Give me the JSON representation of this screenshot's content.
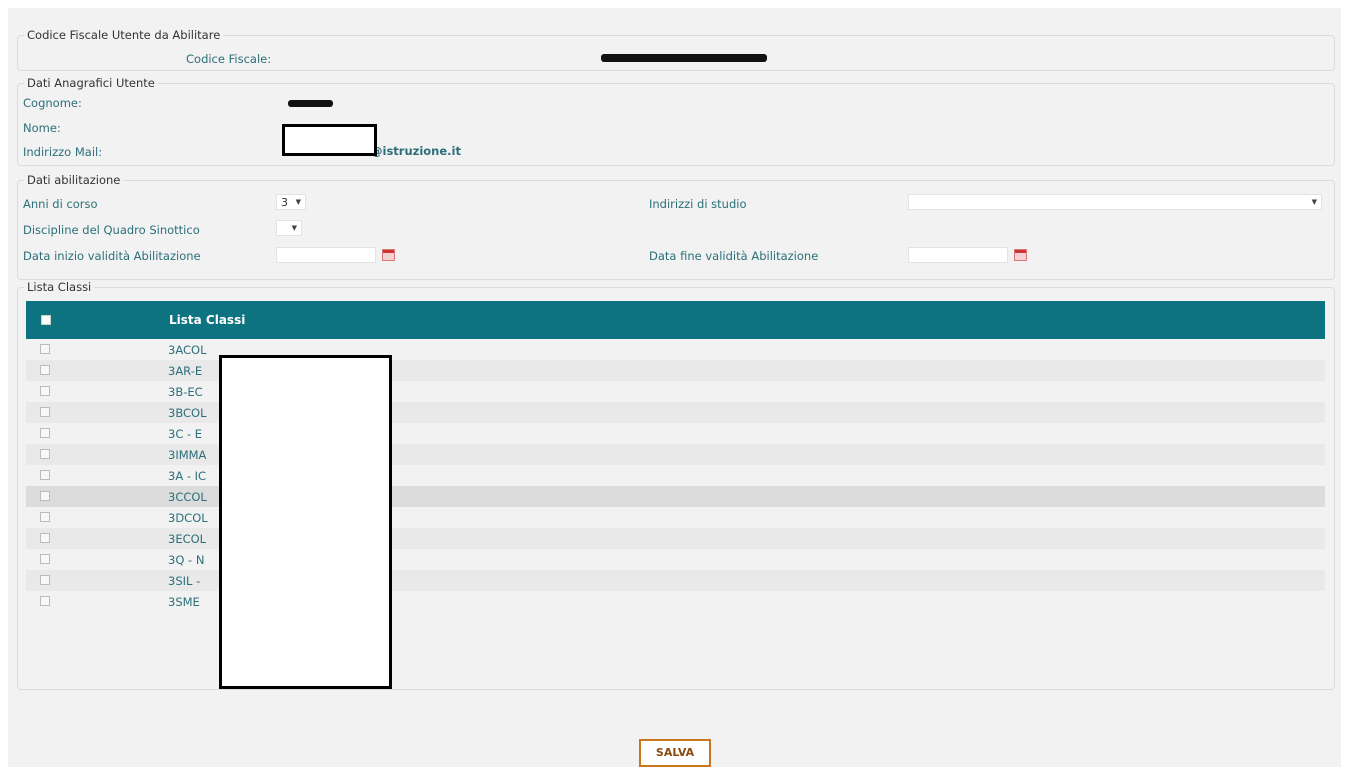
{
  "fiscal_section": {
    "legend": "Codice Fiscale Utente da Abilitare",
    "label": "Codice Fiscale:"
  },
  "user_section": {
    "legend": "Dati Anagrafici Utente",
    "surname_label": "Cognome:",
    "name_label": "Nome:",
    "email_label": "Indirizzo Mail:",
    "email_value": "@istruzione.it"
  },
  "enable_section": {
    "legend": "Dati abilitazione",
    "years_label": "Anni di corso",
    "years_value": "3",
    "paths_label": "Indirizzi di studio",
    "paths_value": "",
    "disciplines_label": "Discipline del Quadro Sinottico",
    "disciplines_value": "",
    "start_label": "Data inizio validità Abilitazione",
    "start_value": "",
    "end_label": "Data fine validità Abilitazione",
    "end_value": ""
  },
  "classes_section": {
    "legend": "Lista Classi",
    "header": "Lista Classi",
    "rows": [
      {
        "text": "3ACOL"
      },
      {
        "text": "3AR-E"
      },
      {
        "text": "3B-EC"
      },
      {
        "text": "3BCOL"
      },
      {
        "text": "3C - E"
      },
      {
        "text": "3IMMA"
      },
      {
        "text": "3A - IC"
      },
      {
        "text": "3CCOL"
      },
      {
        "text": "3DCOL"
      },
      {
        "text": "3ECOL"
      },
      {
        "text": "3Q - N"
      },
      {
        "text": "3SIL -"
      },
      {
        "text": "3SME"
      }
    ]
  },
  "save_button": "SALVA",
  "colors": {
    "header_bg": "#0e7381",
    "label": "#2b6f7a",
    "button_border": "#c8771f"
  },
  "icons": {
    "calendar": "calendar-icon",
    "dropdown": "chevron-down-icon"
  }
}
